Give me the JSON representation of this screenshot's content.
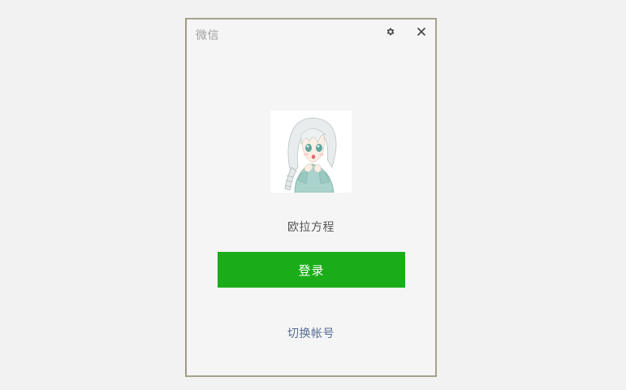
{
  "window": {
    "title": "微信",
    "settings_icon": "gear-icon",
    "close_icon": "close-icon"
  },
  "account": {
    "username": "欧拉方程",
    "avatar": "anime-girl-avatar"
  },
  "actions": {
    "login_label": "登录",
    "switch_account_label": "切换帐号"
  },
  "colors": {
    "background": "#f2f2f2",
    "window_bg": "#f5f5f5",
    "login_button": "#1aad19",
    "link": "#576b95",
    "title_text": "#a0a0a0"
  }
}
